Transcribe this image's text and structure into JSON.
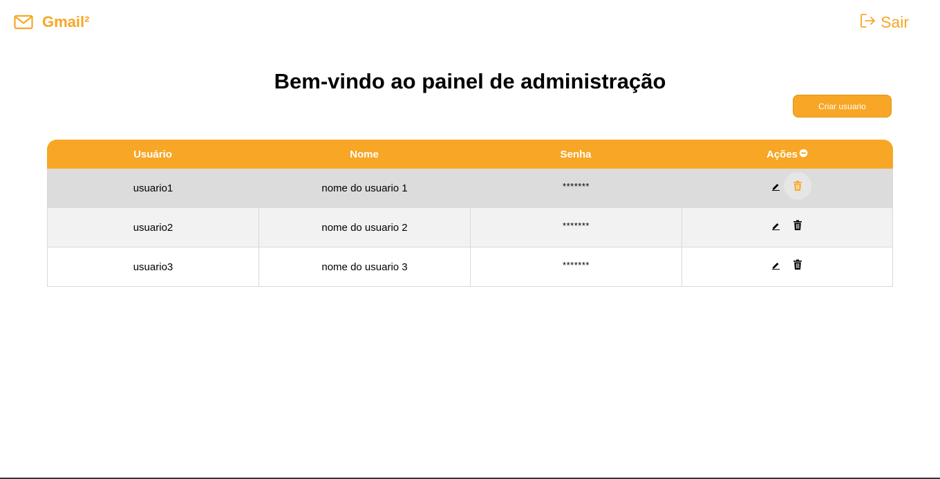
{
  "header": {
    "brand_name": "Gmail²",
    "logout_label": "Sair",
    "brand_color": "#F7A625"
  },
  "main": {
    "title": "Bem-vindo ao painel de administração",
    "create_button_label": "Criar usuario"
  },
  "table": {
    "columns": [
      "Usuário",
      "Nome",
      "Senha",
      "Ações"
    ],
    "rows": [
      {
        "usuario": "usuario1",
        "nome": "nome do usuario 1",
        "senha": "*******"
      },
      {
        "usuario": "usuario2",
        "nome": "nome do usuario 2",
        "senha": "*******"
      },
      {
        "usuario": "usuario3",
        "nome": "nome do usuario 3",
        "senha": "*******"
      }
    ],
    "icons": {
      "edit": "pencil-icon",
      "delete": "trash-icon",
      "header_actions": "circle-info-icon"
    }
  }
}
